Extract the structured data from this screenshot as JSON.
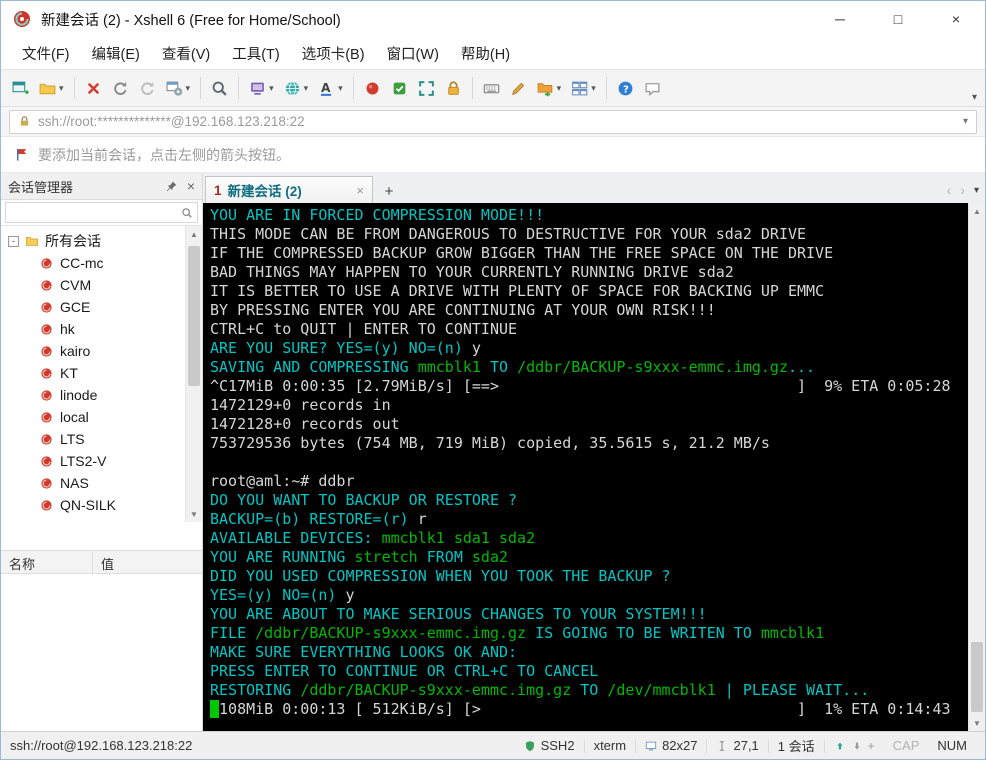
{
  "window": {
    "title": "新建会话 (2) - Xshell 6 (Free for Home/School)",
    "minimize_glyph": "─",
    "maximize_glyph": "□",
    "close_glyph": "×"
  },
  "menu": {
    "items": [
      "文件(F)",
      "编辑(E)",
      "查看(V)",
      "工具(T)",
      "选项卡(B)",
      "窗口(W)",
      "帮助(H)"
    ]
  },
  "toolbar": {
    "buttons": [
      {
        "name": "new-session"
      },
      {
        "name": "open",
        "dropdown": true
      },
      {
        "sep": true
      },
      {
        "name": "disconnect"
      },
      {
        "name": "reconnect"
      },
      {
        "name": "reconnect-all"
      },
      {
        "name": "session-properties",
        "dropdown": true
      },
      {
        "sep": true
      },
      {
        "name": "find"
      },
      {
        "sep": true
      },
      {
        "name": "new-terminal",
        "dropdown": true
      },
      {
        "name": "web-browser",
        "dropdown": true
      },
      {
        "name": "font",
        "dropdown": true
      },
      {
        "sep": true
      },
      {
        "name": "record"
      },
      {
        "name": "log"
      },
      {
        "name": "fullscreen"
      },
      {
        "name": "lock"
      },
      {
        "sep": true
      },
      {
        "name": "virtual-keyboard"
      },
      {
        "name": "compose"
      },
      {
        "name": "file-transfer",
        "dropdown": true
      },
      {
        "name": "tile-windows",
        "dropdown": true
      },
      {
        "sep": true
      },
      {
        "name": "help"
      },
      {
        "name": "feedback"
      }
    ],
    "overflow_glyph": "▾"
  },
  "addressbar": {
    "value": "ssh://root:**************@192.168.123.218:22",
    "dropdown_glyph": "▾"
  },
  "infobar": {
    "text": "要添加当前会话，点击左侧的箭头按钮。"
  },
  "sidebar": {
    "title": "会话管理器",
    "close_glyph": "×",
    "expander_glyph": "-",
    "tree_root_label": "所有会话",
    "sessions": [
      "CC-mc",
      "CVM",
      "GCE",
      "hk",
      "kairo",
      "KT",
      "linode",
      "local",
      "LTS",
      "LTS2-V",
      "NAS",
      "QN-SILK",
      ""
    ],
    "props": {
      "name_header": "名称",
      "value_header": "值"
    }
  },
  "tabbar": {
    "active_tab": {
      "number": "1",
      "label": "新建会话 (2)",
      "close_glyph": "×"
    },
    "new_tab_glyph": "+",
    "nav_left_glyph": "‹",
    "nav_right_glyph": "›",
    "menu_glyph": "▾"
  },
  "terminal": {
    "lines": [
      [
        {
          "c": "cyan",
          "t": "YOU ARE IN FORCED COMPRESSION MODE!!!"
        }
      ],
      [
        {
          "c": "white",
          "t": "THIS MODE CAN BE FROM DANGEROUS TO DESTRUCTIVE FOR YOUR sda2 DRIVE"
        }
      ],
      [
        {
          "c": "white",
          "t": "IF THE COMPRESSED BACKUP GROW BIGGER THAN THE FREE SPACE ON THE DRIVE"
        }
      ],
      [
        {
          "c": "white",
          "t": "BAD THINGS MAY HAPPEN TO YOUR CURRENTLY RUNNING DRIVE sda2"
        }
      ],
      [
        {
          "c": "white",
          "t": "IT IS BETTER TO USE A DRIVE WITH PLENTY OF SPACE FOR BACKING UP EMMC"
        }
      ],
      [
        {
          "c": "white",
          "t": "BY PRESSING ENTER YOU ARE CONTINUING AT YOUR OWN RISK!!!"
        }
      ],
      [
        {
          "c": "white",
          "t": "CTRL+C to QUIT | ENTER TO CONTINUE"
        }
      ],
      [
        {
          "c": "cyan",
          "t": "ARE YOU SURE? YES=(y) NO=(n) "
        },
        {
          "c": "white",
          "t": "y"
        }
      ],
      [
        {
          "c": "cyan",
          "t": "SAVING AND COMPRESSING "
        },
        {
          "c": "green",
          "t": "mmcblk1"
        },
        {
          "c": "cyan",
          "t": " TO "
        },
        {
          "c": "green",
          "t": "/ddbr/BACKUP-s9xxx-emmc.img.gz"
        },
        {
          "c": "cyan",
          "t": "..."
        }
      ],
      [
        {
          "c": "white",
          "t": "^C17MiB 0:00:35 [2.79MiB/s] [==>                                 ]  9% ETA 0:05:28"
        }
      ],
      [
        {
          "c": "white",
          "t": "1472129+0 records in"
        }
      ],
      [
        {
          "c": "white",
          "t": "1472128+0 records out"
        }
      ],
      [
        {
          "c": "white",
          "t": "753729536 bytes (754 MB, 719 MiB) copied, 35.5615 s, 21.2 MB/s"
        }
      ],
      [],
      [
        {
          "c": "white",
          "t": "root@aml:~# ddbr"
        }
      ],
      [
        {
          "c": "cyan",
          "t": "DO YOU WANT TO BACKUP OR RESTORE ?"
        }
      ],
      [
        {
          "c": "cyan",
          "t": "BACKUP=(b) RESTORE=(r) "
        },
        {
          "c": "white",
          "t": "r"
        }
      ],
      [
        {
          "c": "cyan",
          "t": "AVAILABLE DEVICES: "
        },
        {
          "c": "green",
          "t": "mmcblk1 sda1 sda2"
        }
      ],
      [
        {
          "c": "cyan",
          "t": "YOU ARE RUNNING "
        },
        {
          "c": "green",
          "t": "stretch"
        },
        {
          "c": "cyan",
          "t": " FROM "
        },
        {
          "c": "green",
          "t": "sda2"
        }
      ],
      [
        {
          "c": "cyan",
          "t": "DID YOU USED COMPRESSION WHEN YOU TOOK THE BACKUP ?"
        }
      ],
      [
        {
          "c": "cyan",
          "t": "YES=(y) NO=(n) "
        },
        {
          "c": "white",
          "t": "y"
        }
      ],
      [
        {
          "c": "cyan",
          "t": "YOU ARE ABOUT TO MAKE SERIOUS CHANGES TO YOUR SYSTEM!!!"
        }
      ],
      [
        {
          "c": "cyan",
          "t": "FILE "
        },
        {
          "c": "green",
          "t": "/ddbr/BACKUP-s9xxx-emmc.img.gz"
        },
        {
          "c": "cyan",
          "t": " IS GOING TO BE WRITEN TO "
        },
        {
          "c": "green",
          "t": "mmcblk1"
        }
      ],
      [
        {
          "c": "cyan",
          "t": "MAKE SURE EVERYTHING LOOKS OK AND:"
        }
      ],
      [
        {
          "c": "cyan",
          "t": "PRESS ENTER TO CONTINUE OR CTRL+C TO CANCEL"
        }
      ],
      [
        {
          "c": "cyan",
          "t": "RESTORING "
        },
        {
          "c": "green",
          "t": "/ddbr/BACKUP-s9xxx-emmc.img.gz"
        },
        {
          "c": "cyan",
          "t": " TO "
        },
        {
          "c": "green",
          "t": "/dev/mmcblk1"
        },
        {
          "c": "cyan",
          "t": " | PLEASE WAIT..."
        }
      ],
      [
        {
          "c": "cursor",
          "t": " "
        },
        {
          "c": "white",
          "t": "108MiB 0:00:13 [ 512KiB/s] [>                                   ]  1% ETA 0:14:43"
        }
      ]
    ]
  },
  "statusbar": {
    "left": "ssh://root@192.168.123.218:22",
    "protocol": "SSH2",
    "terminal_type": "xterm",
    "screen_size": "82x27",
    "cursor_position": "27,1",
    "session_count": "1 会话",
    "plus_glyph": "+",
    "caps_indicator": "CAP",
    "num_indicator": "NUM"
  },
  "colors": {
    "terminal_bg": "#000000",
    "terminal_cyan": "#00c5c5",
    "terminal_green": "#00b800",
    "terminal_white": "#d6d6d6",
    "terminal_cursor": "#00c800",
    "tab_label": "#0e6e80",
    "tab_number": "#9b3226"
  }
}
